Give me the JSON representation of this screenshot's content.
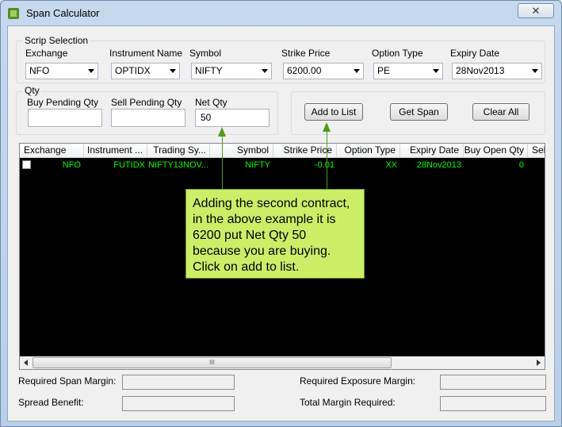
{
  "window": {
    "title": "Span Calculator",
    "close_glyph": "✕"
  },
  "scrip_selection": {
    "group_label": "Scrip Selection",
    "fields": [
      {
        "label": "Exchange",
        "value": "NFO"
      },
      {
        "label": "Instrument Name",
        "value": "OPTIDX"
      },
      {
        "label": "Symbol",
        "value": "NIFTY"
      },
      {
        "label": "Strike Price",
        "value": "6200.00"
      },
      {
        "label": "Option Type",
        "value": "PE"
      },
      {
        "label": "Expiry Date",
        "value": "28Nov2013"
      }
    ]
  },
  "qty": {
    "group_label": "Qty",
    "buy_pending_label": "Buy Pending Qty",
    "buy_pending_value": "",
    "sell_pending_label": "Sell Pending Qty",
    "sell_pending_value": "",
    "net_label": "Net Qty",
    "net_value": "50"
  },
  "actions": {
    "add_to_list": "Add to List",
    "get_span": "Get Span",
    "clear_all": "Clear All"
  },
  "grid": {
    "columns": [
      "Exchange",
      "Instrument ...",
      "Trading Sy...",
      "Symbol",
      "Strike Price",
      "Option Type",
      "Expiry Date",
      "Buy Open Qty",
      "Sel"
    ],
    "rows": [
      {
        "checked": false,
        "exchange": "NFO",
        "instrument": "FUTIDX",
        "trading_symbol": "NIFTY13NOV...",
        "symbol": "NIFTY",
        "strike_price": "-0.01",
        "option_type": "XX",
        "expiry_date": "28Nov2013",
        "buy_open_qty": "0"
      }
    ],
    "scroll_thumb_grip": "III"
  },
  "summary": {
    "required_span_margin_label": "Required Span Margin:",
    "spread_benefit_label": "Spread Benefit:",
    "required_exposure_margin_label": "Required Exposure Margin:",
    "total_margin_required_label": "Total Margin Required:"
  },
  "annotation": {
    "text": "Adding the second contract, in the above example it is 6200 put Net Qty 50 because you are buying. Click on add to list."
  },
  "colors": {
    "grid_background": "#000000",
    "grid_text": "#00ff00",
    "callout_fill": "#ccee66",
    "arrow": "#4f9a1e"
  }
}
